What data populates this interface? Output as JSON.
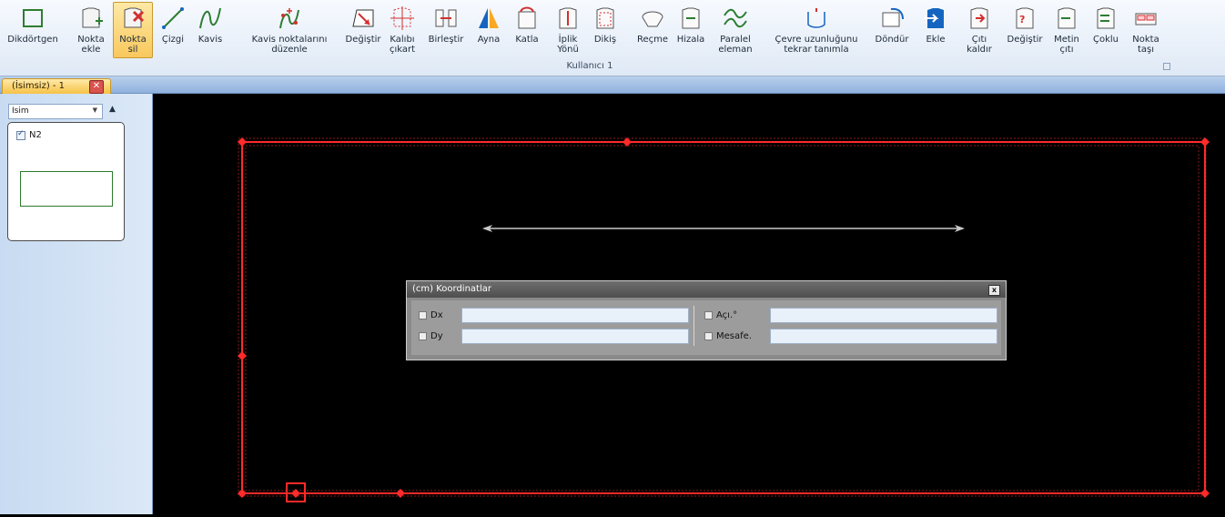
{
  "ribbon": {
    "group_label": "Kullanıcı 1",
    "buttons": [
      {
        "id": "dikdortgen",
        "label": "Dikdörtgen",
        "icon": "rectangle-icon"
      },
      {
        "id": "nokta-ekle",
        "label": "Nokta\nekle",
        "icon": "add-point-icon"
      },
      {
        "id": "nokta-sil",
        "label": "Nokta\nsil",
        "icon": "delete-point-icon",
        "active": true
      },
      {
        "id": "cizgi",
        "label": "Çizgi",
        "icon": "line-icon"
      },
      {
        "id": "kavis",
        "label": "Kavis",
        "icon": "curve-icon"
      },
      {
        "id": "kavis-duzenle",
        "label": "Kavis noktalarını\ndüzenle",
        "icon": "curve-points-icon"
      },
      {
        "id": "degistir",
        "label": "Değiştir",
        "icon": "modify-icon"
      },
      {
        "id": "kalibi-cikart",
        "label": "Kalıbı\nçıkart",
        "icon": "extract-pattern-icon"
      },
      {
        "id": "birlestir",
        "label": "Birleştir",
        "icon": "merge-icon"
      },
      {
        "id": "ayna",
        "label": "Ayna",
        "icon": "mirror-icon"
      },
      {
        "id": "katla",
        "label": "Katla",
        "icon": "fold-icon"
      },
      {
        "id": "iplik-yonu",
        "label": "İplik\nYönü",
        "icon": "grain-line-icon"
      },
      {
        "id": "dikis",
        "label": "Dikiş",
        "icon": "seam-icon"
      },
      {
        "id": "recme",
        "label": "Reçme",
        "icon": "dart-icon"
      },
      {
        "id": "hizala",
        "label": "Hizala",
        "icon": "align-icon"
      },
      {
        "id": "paralel-eleman",
        "label": "Paralel\neleman",
        "icon": "parallel-icon"
      },
      {
        "id": "cevre-uzunlugu",
        "label": "Çevre uzunluğunu\ntekrar tanımla",
        "icon": "perimeter-icon"
      },
      {
        "id": "dondur",
        "label": "Döndür",
        "icon": "rotate-icon"
      },
      {
        "id": "ekle",
        "label": "Ekle",
        "icon": "insert-icon"
      },
      {
        "id": "cit-kaldir",
        "label": "Çıtı\nkaldır",
        "icon": "remove-notch-icon"
      },
      {
        "id": "degistir2",
        "label": "Değiştir",
        "icon": "change-notch-icon"
      },
      {
        "id": "metin-citi",
        "label": "Metin\nçıtı",
        "icon": "text-notch-icon"
      },
      {
        "id": "coklu",
        "label": "Çoklu",
        "icon": "multi-notch-icon"
      },
      {
        "id": "nokta-tasi",
        "label": "Nokta\ntaşı",
        "icon": "move-point-icon"
      }
    ]
  },
  "tab": {
    "title": "(İsimsiz) - 1",
    "close": "✕"
  },
  "sidebar": {
    "sort_select": "Isim",
    "sort_arrow": "▲",
    "layers": [
      {
        "name": "N2",
        "checked": true
      }
    ]
  },
  "dialog": {
    "title": "(cm) Koordinatlar",
    "close": "x",
    "dx_label": "Dx",
    "dy_label": "Dy",
    "angle_label": "Açı.°",
    "distance_label": "Mesafe.",
    "dx_value": "",
    "dy_value": "",
    "angle_value": "",
    "distance_value": ""
  },
  "colors": {
    "canvas_bg": "#000000",
    "outline": "#ff2a2a",
    "grainline": "#c8c8c8"
  }
}
